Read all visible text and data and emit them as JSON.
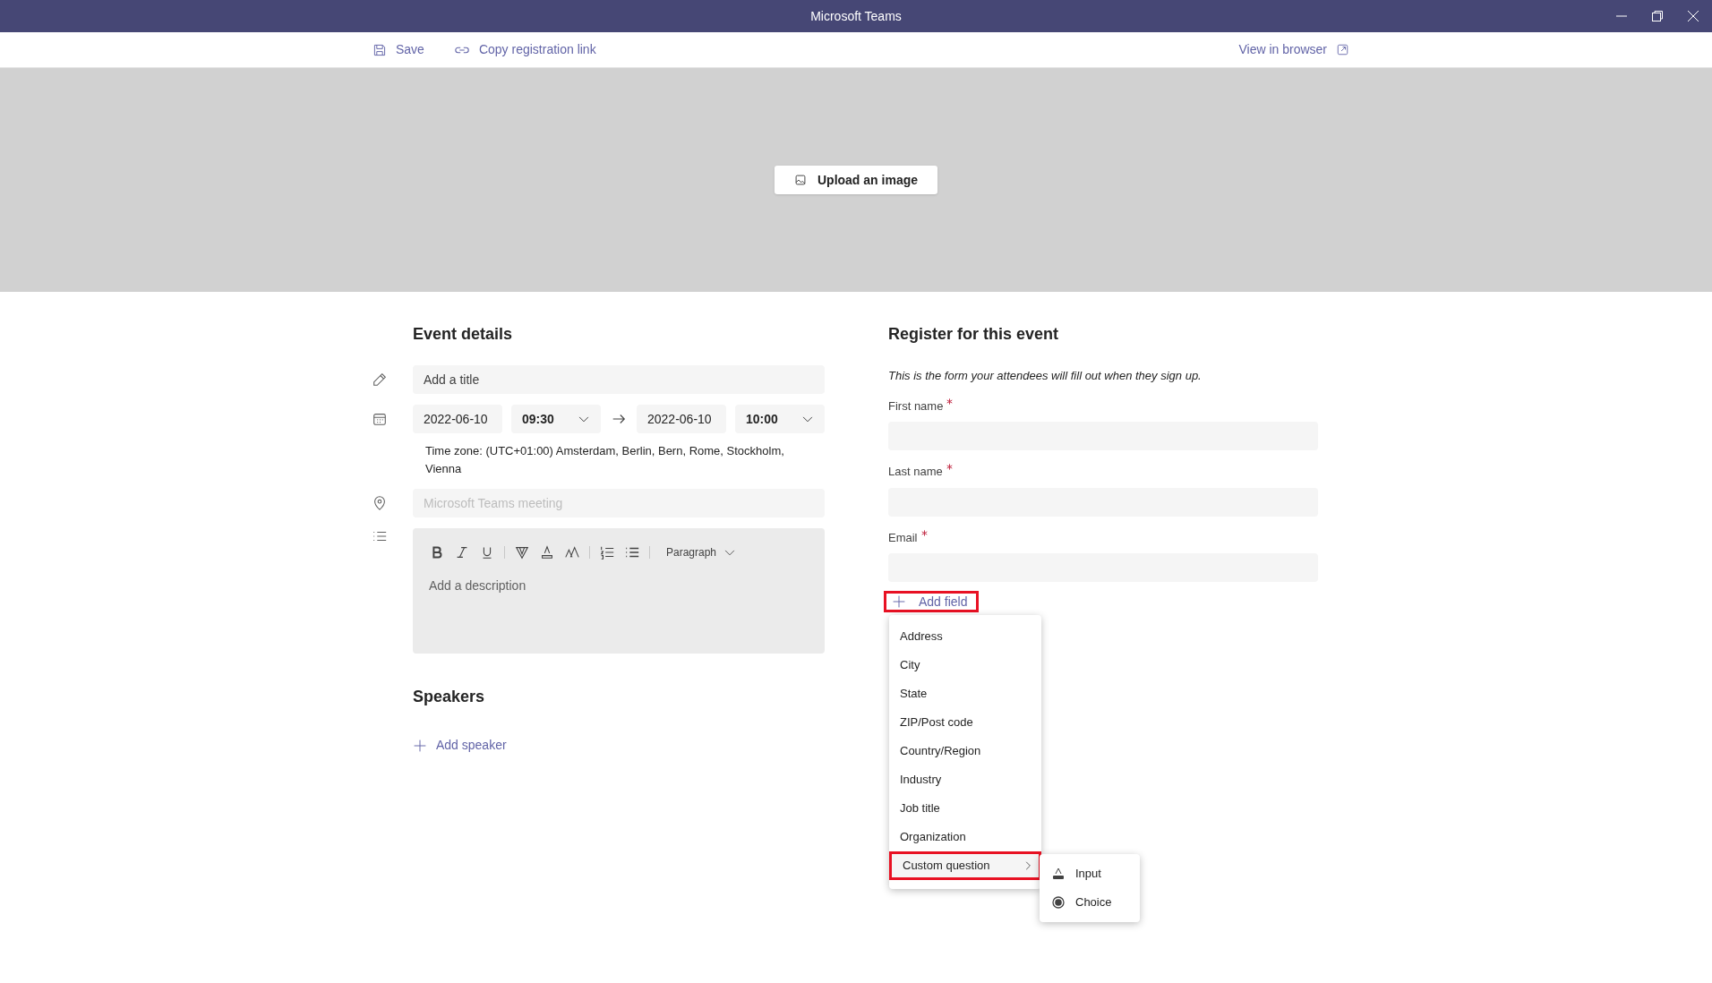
{
  "window": {
    "title": "Microsoft Teams"
  },
  "toolbar": {
    "save": "Save",
    "copy_link": "Copy registration link",
    "view_in_browser": "View in browser"
  },
  "banner": {
    "upload_button": "Upload an image"
  },
  "event_details": {
    "heading": "Event details",
    "title_placeholder": "Add a title",
    "start_date": "2022-06-10",
    "start_time": "09:30",
    "end_date": "2022-06-10",
    "end_time": "10:00",
    "time_zone": "Time zone: (UTC+01:00) Amsterdam, Berlin, Bern, Rome, Stockholm, Vienna",
    "location_placeholder": "Microsoft Teams meeting",
    "format_dropdown": "Paragraph",
    "description_placeholder": "Add a description"
  },
  "speakers": {
    "heading": "Speakers",
    "add_speaker": "Add speaker"
  },
  "registration": {
    "heading": "Register for this event",
    "note": "This is the form your attendees will fill out when they sign up.",
    "fields": [
      {
        "label": "First name",
        "required": true
      },
      {
        "label": "Last name",
        "required": true
      },
      {
        "label": "Email",
        "required": true
      }
    ],
    "add_field": {
      "label": "Add field",
      "highlighted": true
    }
  },
  "add_field_menu": {
    "items": [
      {
        "label": "Address",
        "highlighted": false,
        "has_submenu": false
      },
      {
        "label": "City",
        "highlighted": false,
        "has_submenu": false
      },
      {
        "label": "State",
        "highlighted": false,
        "has_submenu": false
      },
      {
        "label": "ZIP/Post code",
        "highlighted": false,
        "has_submenu": false
      },
      {
        "label": "Country/Region",
        "highlighted": false,
        "has_submenu": false
      },
      {
        "label": "Industry",
        "highlighted": false,
        "has_submenu": false
      },
      {
        "label": "Job title",
        "highlighted": false,
        "has_submenu": false
      },
      {
        "label": "Organization",
        "highlighted": false,
        "has_submenu": false
      },
      {
        "label": "Custom question",
        "highlighted": true,
        "has_submenu": true
      }
    ]
  },
  "submenu": {
    "items": [
      {
        "label": "Input",
        "kind": "input"
      },
      {
        "label": "Choice",
        "kind": "choice"
      }
    ]
  }
}
